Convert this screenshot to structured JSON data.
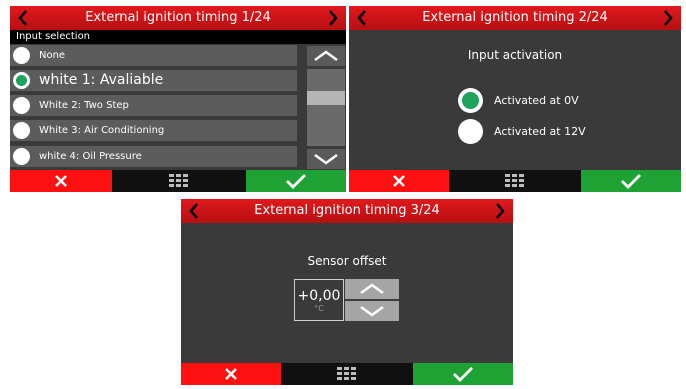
{
  "colors": {
    "title_red": "#d0161a",
    "cancel_red": "#ff1010",
    "ok_green": "#1fa234",
    "selected_green": "#1fa25a",
    "panel_bg": "#3a3a3a"
  },
  "panel1": {
    "title": "External ignition timing 1/24",
    "subheader": "Input selection",
    "options": [
      {
        "label": "None",
        "selected": false
      },
      {
        "label": "white 1: Avaliable",
        "selected": true
      },
      {
        "label": "White 2: Two Step",
        "selected": false
      },
      {
        "label": "White 3: Air Conditioning",
        "selected": false
      },
      {
        "label": "white 4: Oil Pressure",
        "selected": false
      }
    ],
    "scroll_position": 0.35,
    "icons": {
      "prev": "chevron-left-icon",
      "next": "chevron-right-icon",
      "scroll_up": "chevron-up-icon",
      "scroll_down": "chevron-down-icon",
      "cancel": "x-icon",
      "menu": "grid-icon",
      "ok": "check-icon"
    }
  },
  "panel2": {
    "title": "External ignition timing 2/24",
    "heading": "Input activation",
    "options": [
      {
        "label": "Activated at 0V",
        "selected": true
      },
      {
        "label": "Activated at 12V",
        "selected": false
      }
    ],
    "icons": {
      "prev": "chevron-left-icon",
      "next": "chevron-right-icon",
      "cancel": "x-icon",
      "menu": "grid-icon",
      "ok": "check-icon"
    }
  },
  "panel3": {
    "title": "External ignition timing 3/24",
    "heading": "Sensor offset",
    "value": "+0,00",
    "unit": "°C",
    "icons": {
      "prev": "chevron-left-icon",
      "next": "chevron-right-icon",
      "increment": "chevron-up-icon",
      "decrement": "chevron-down-icon",
      "cancel": "x-icon",
      "menu": "grid-icon",
      "ok": "check-icon"
    }
  }
}
